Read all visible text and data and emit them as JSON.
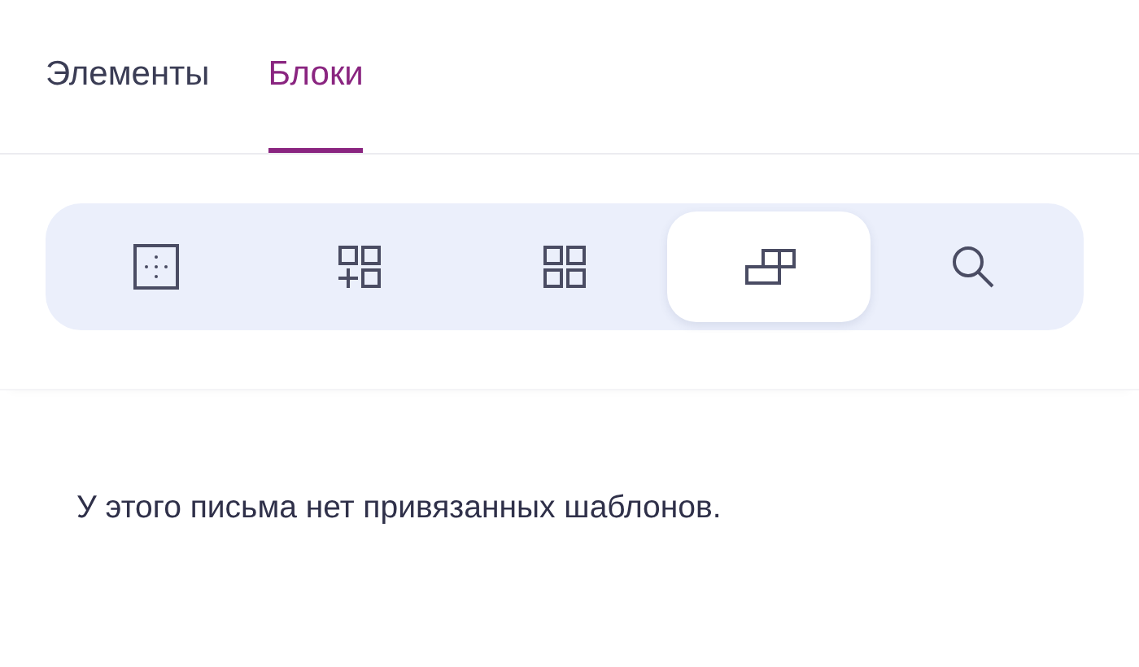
{
  "tabs": [
    {
      "label": "Элементы",
      "selected": false
    },
    {
      "label": "Блоки",
      "selected": true
    }
  ],
  "toolbar": [
    {
      "kind": "frame",
      "selected": false
    },
    {
      "kind": "add-grid",
      "selected": false
    },
    {
      "kind": "grid",
      "selected": false
    },
    {
      "kind": "blocks",
      "selected": true
    },
    {
      "kind": "search",
      "selected": false
    }
  ],
  "message": "У этого письма нет привязанных шаблонов."
}
